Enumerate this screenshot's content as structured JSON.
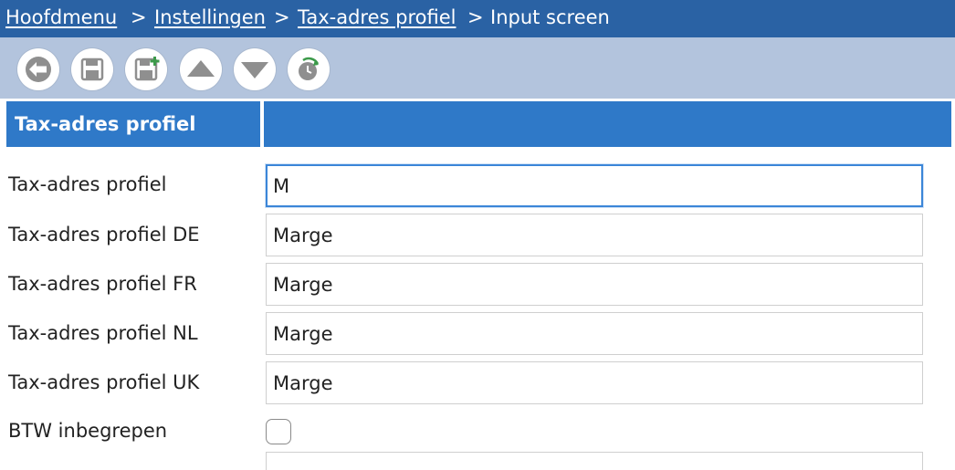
{
  "breadcrumb": {
    "items": [
      "Hoofdmenu",
      "Instellingen",
      "Tax-adres profiel",
      "Input screen"
    ],
    "separator": ">"
  },
  "toolbar": {
    "buttons": [
      {
        "name": "back",
        "icon": "arrow-left-icon"
      },
      {
        "name": "save",
        "icon": "floppy-icon"
      },
      {
        "name": "save-new",
        "icon": "floppy-plus-icon"
      },
      {
        "name": "move-up",
        "icon": "triangle-up-icon"
      },
      {
        "name": "move-down",
        "icon": "triangle-down-icon"
      },
      {
        "name": "history",
        "icon": "clock-refresh-icon"
      }
    ]
  },
  "section": {
    "title": "Tax-adres profiel"
  },
  "form": {
    "fields": [
      {
        "label": "Tax-adres profiel",
        "value": "M"
      },
      {
        "label": "Tax-adres profiel DE",
        "value": "Marge"
      },
      {
        "label": "Tax-adres profiel FR",
        "value": "Marge"
      },
      {
        "label": "Tax-adres profiel NL",
        "value": "Marge"
      },
      {
        "label": "Tax-adres profiel UK",
        "value": "Marge"
      }
    ],
    "checkbox": {
      "label": "BTW inbegrepen",
      "checked": false
    }
  },
  "colors": {
    "topbar": "#2a62a4",
    "toolbar": "#b3c4dd",
    "section_header": "#2f79c8",
    "focus_border": "#3b86d8"
  }
}
